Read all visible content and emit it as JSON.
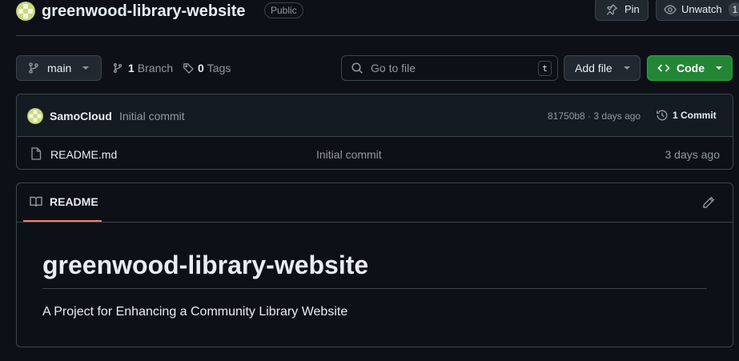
{
  "repo": {
    "name": "greenwood-library-website",
    "visibility": "Public",
    "pin_label": "Pin",
    "watch_label": "Unwatch",
    "watch_count": "1"
  },
  "toolbar": {
    "branch": "main",
    "branch_count": "1",
    "branch_label": "Branch",
    "tag_count": "0",
    "tag_label": "Tags",
    "search_placeholder": "Go to file",
    "search_shortcut": "t",
    "add_file_label": "Add file",
    "code_label": "Code"
  },
  "latest_commit": {
    "author": "SamoCloud",
    "message": "Initial commit",
    "meta": "81750b8 · 3 days ago",
    "commit_count": "1 Commit"
  },
  "files": [
    {
      "name": "README.md",
      "commit": "Initial commit",
      "date": "3 days ago"
    }
  ],
  "readme": {
    "tab_label": "README",
    "heading": "greenwood-library-website",
    "description": "A Project for Enhancing a Community Library Website"
  },
  "colors": {
    "background": "#0d1117",
    "border": "#3d444d",
    "code_button": "#238636",
    "readme_tab_underline": "#f78166",
    "avatar": "#c9d97e"
  },
  "icons": [
    "avatar",
    "pin-icon",
    "eye-icon",
    "git-branch-icon",
    "tag-icon",
    "search-icon",
    "code-icon",
    "history-icon",
    "file-icon",
    "book-icon",
    "pencil-icon",
    "chevron-down-icon"
  ]
}
